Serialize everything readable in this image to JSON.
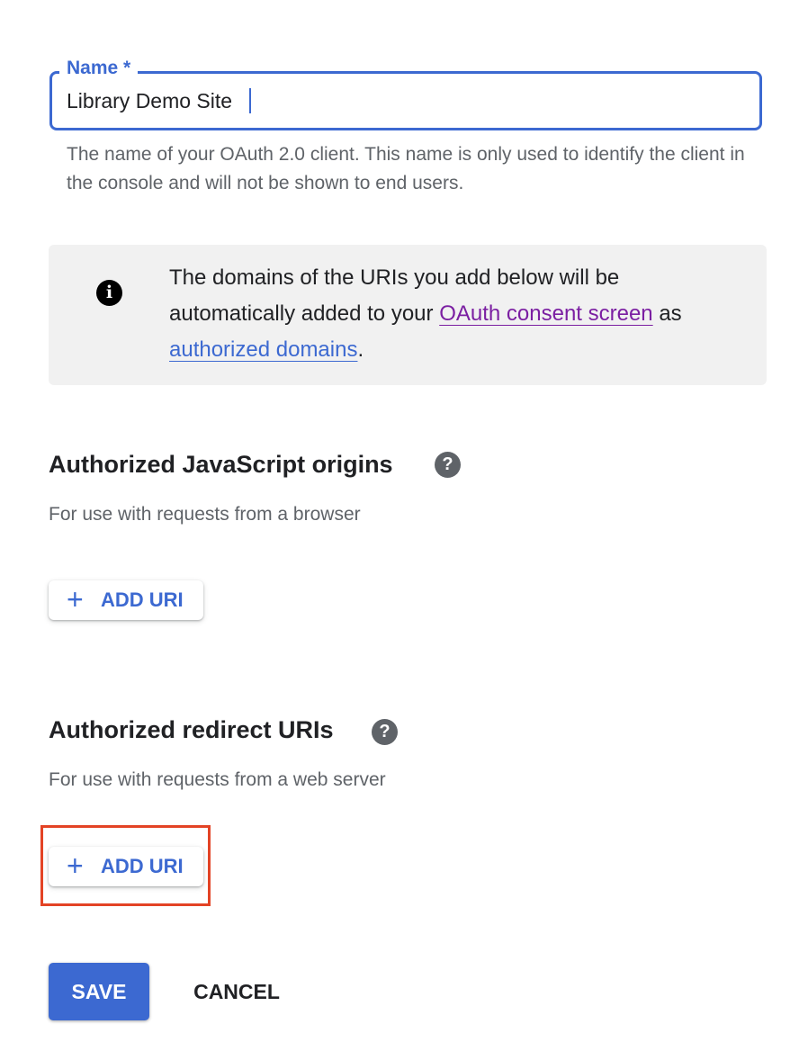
{
  "name_field": {
    "label": "Name *",
    "value": "Library Demo Site",
    "hint": "The name of your OAuth 2.0 client. This name is only used to identify the client in the console and will not be shown to end users."
  },
  "info_box": {
    "icon": "info-icon",
    "text_before": "The domains of the URIs you add below will be automatically added to your ",
    "consent_link": "OAuth consent screen",
    "text_middle": " as ",
    "domains_link": "authorized domains",
    "text_after": "."
  },
  "js_origins": {
    "title": "Authorized JavaScript origins",
    "description": "For use with requests from a browser",
    "help_icon": "help-icon",
    "add_button": {
      "icon": "+",
      "label": "ADD URI"
    }
  },
  "redirect_uris": {
    "title": "Authorized redirect URIs",
    "description": "For use with requests from a web server",
    "help_icon": "help-icon",
    "add_button": {
      "icon": "+",
      "label": "ADD URI"
    }
  },
  "footer": {
    "save_label": "SAVE",
    "cancel_label": "CANCEL"
  },
  "colors": {
    "primary": "#3c69d1",
    "link_visited": "#7b1fa2",
    "highlight": "#e34325",
    "info_background": "#f1f1f1"
  }
}
